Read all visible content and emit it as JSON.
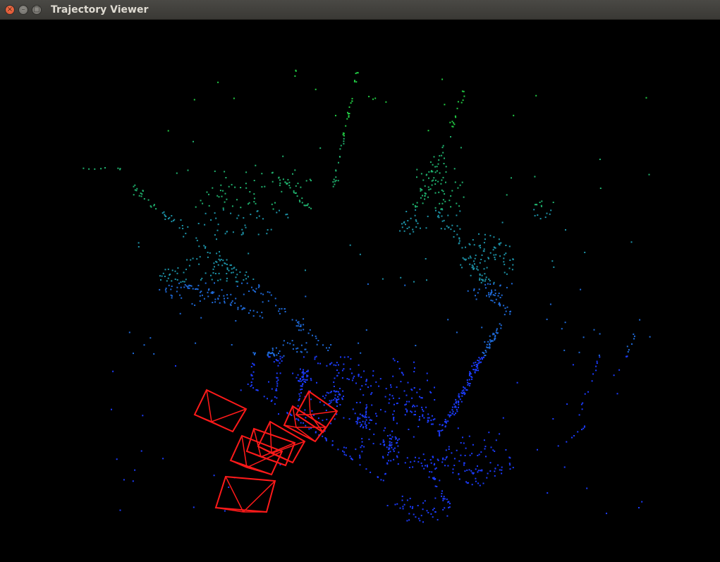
{
  "window": {
    "title": "Trajectory Viewer",
    "buttons": [
      {
        "name": "close",
        "glyph": "×",
        "icon": "close-icon"
      },
      {
        "name": "minimize",
        "glyph": "–",
        "icon": "minimize-icon"
      },
      {
        "name": "maximize",
        "glyph": "□",
        "icon": "maximize-icon"
      }
    ]
  },
  "viewer": {
    "background": "#000000",
    "camera_color": "#ff1a1a",
    "cloud_colors": [
      "#1c3cff",
      "#1f6ad9",
      "#1d93a8",
      "#20b26e",
      "#22cc44"
    ]
  }
}
